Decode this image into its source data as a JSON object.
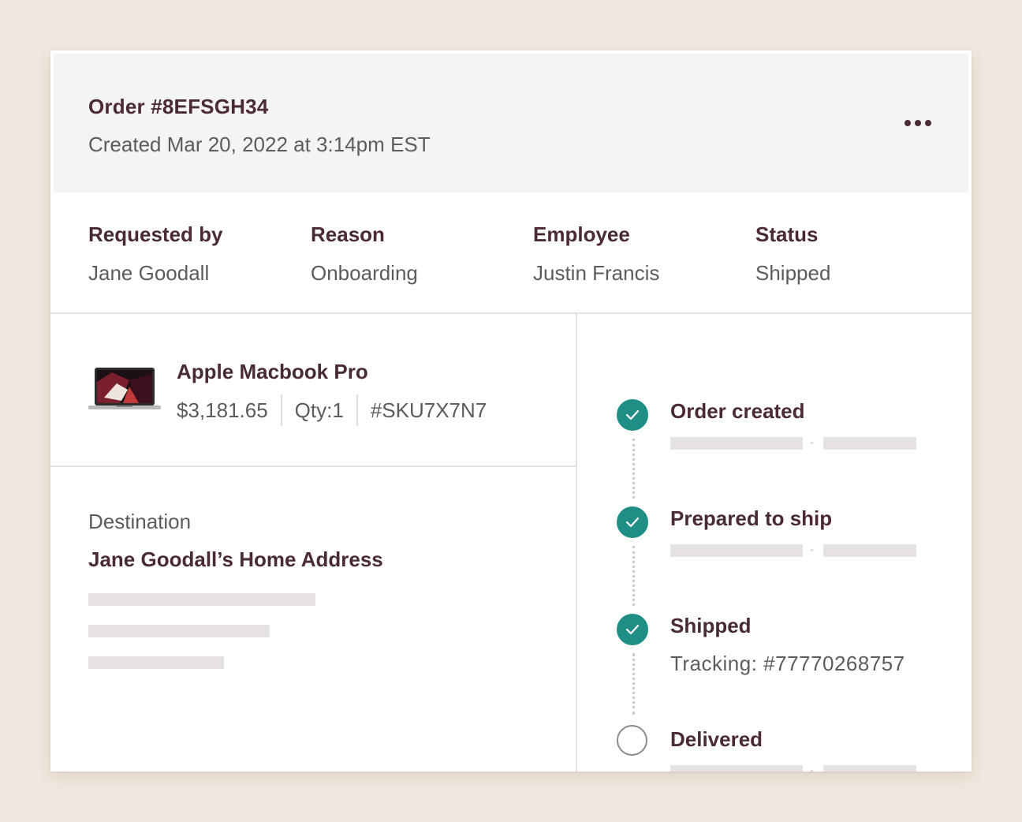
{
  "order": {
    "title": "Order #8EFSGH34",
    "created": "Created Mar 20, 2022 at 3:14pm EST",
    "menu_icon": "more-horizontal-icon"
  },
  "meta": [
    {
      "label": "Requested by",
      "value": "Jane Goodall"
    },
    {
      "label": "Reason",
      "value": "Onboarding"
    },
    {
      "label": "Employee",
      "value": "Justin Francis"
    },
    {
      "label": "Status",
      "value": "Shipped"
    }
  ],
  "product": {
    "name": "Apple Macbook Pro",
    "price": "$3,181.65",
    "qty": "Qty:1",
    "sku": "#SKU7X7N7",
    "image_icon": "laptop-icon"
  },
  "destination": {
    "label": "Destination",
    "name": "Jane Goodall’s Home Address"
  },
  "timeline": [
    {
      "title": "Order created",
      "done": true
    },
    {
      "title": "Prepared to ship",
      "done": true
    },
    {
      "title": "Shipped",
      "done": true,
      "sub": "Tracking: #77770268757"
    },
    {
      "title": "Delivered",
      "done": false
    }
  ],
  "colors": {
    "background": "#f0e7de",
    "heading": "#4a2a38",
    "text": "#5f5a5c",
    "complete": "#1f8f86",
    "placeholder": "#e6e2e2"
  }
}
